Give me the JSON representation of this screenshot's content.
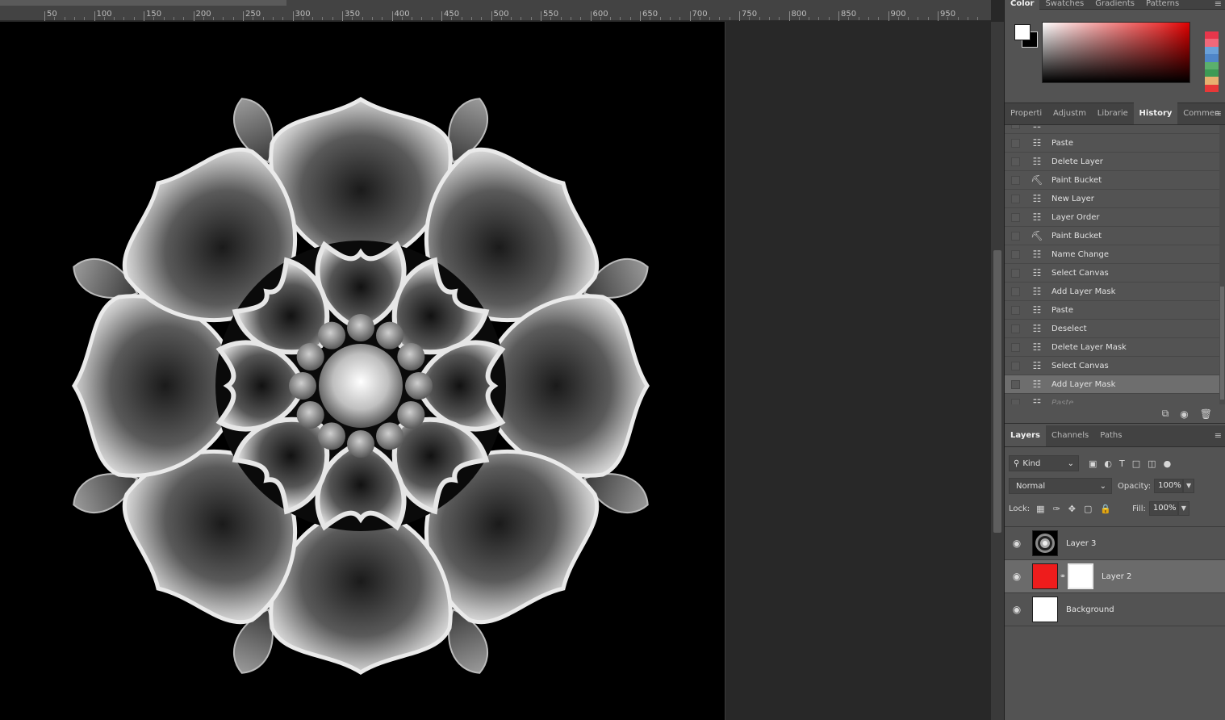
{
  "ruler": {
    "labels": [
      "50",
      "100",
      "150",
      "200",
      "250",
      "300",
      "350",
      "400",
      "450",
      "500",
      "550",
      "600",
      "650",
      "700",
      "750",
      "800",
      "850",
      "900",
      "950"
    ]
  },
  "color_panel": {
    "tabs": [
      "Color",
      "Swatches",
      "Gradients",
      "Patterns"
    ],
    "active_tab": "Color",
    "foreground": "#ffffff",
    "background": "#000000",
    "accent": "#e02020",
    "hue_swatches": [
      "#e8364b",
      "#f0687a",
      "#6aa0d8",
      "#4f86c8",
      "#5bb06c",
      "#3d9a55",
      "#e8b070",
      "#e83838"
    ]
  },
  "history_panel": {
    "tabs": [
      "Properti",
      "Adjustm",
      "Librarie",
      "History",
      "Commen"
    ],
    "active_tab": "History",
    "items": [
      {
        "label": "",
        "icon": "document-icon",
        "state": "normal"
      },
      {
        "label": "Paste",
        "icon": "document-icon",
        "state": "normal"
      },
      {
        "label": "Delete Layer",
        "icon": "document-icon",
        "state": "normal"
      },
      {
        "label": "Paint Bucket",
        "icon": "paint-bucket-icon",
        "state": "normal"
      },
      {
        "label": "New Layer",
        "icon": "document-icon",
        "state": "normal"
      },
      {
        "label": "Layer Order",
        "icon": "document-icon",
        "state": "normal"
      },
      {
        "label": "Paint Bucket",
        "icon": "paint-bucket-icon",
        "state": "normal"
      },
      {
        "label": "Name Change",
        "icon": "document-icon",
        "state": "normal"
      },
      {
        "label": "Select Canvas",
        "icon": "document-icon",
        "state": "normal"
      },
      {
        "label": "Add Layer Mask",
        "icon": "document-icon",
        "state": "normal"
      },
      {
        "label": "Paste",
        "icon": "document-icon",
        "state": "normal"
      },
      {
        "label": "Deselect",
        "icon": "document-icon",
        "state": "normal"
      },
      {
        "label": "Delete Layer Mask",
        "icon": "document-icon",
        "state": "normal"
      },
      {
        "label": "Select Canvas",
        "icon": "document-icon",
        "state": "normal"
      },
      {
        "label": "Add Layer Mask",
        "icon": "document-icon",
        "state": "selected"
      },
      {
        "label": "Paste",
        "icon": "document-icon",
        "state": "dim"
      }
    ],
    "footer_icons": [
      "new-document-from-state-icon",
      "snapshot-camera-icon",
      "trash-icon"
    ]
  },
  "layers_panel": {
    "tabs": [
      "Layers",
      "Channels",
      "Paths"
    ],
    "active_tab": "Layers",
    "filter": {
      "label": "Kind",
      "icons": [
        "image-filter-icon",
        "adjustment-filter-icon",
        "type-filter-icon",
        "shape-filter-icon",
        "smart-object-filter-icon",
        "filter-toggle-icon"
      ]
    },
    "blend_mode": "Normal",
    "opacity_label": "Opacity:",
    "opacity_value": "100%",
    "lock_label": "Lock:",
    "lock_icons": [
      "lock-transparent-icon",
      "lock-paint-icon",
      "lock-move-icon",
      "lock-artboard-icon",
      "lock-all-icon"
    ],
    "fill_label": "Fill:",
    "fill_value": "100%",
    "layers": [
      {
        "name": "Layer 3",
        "thumb": "rosette",
        "mask": false,
        "selected": false
      },
      {
        "name": "Layer 2",
        "thumb": "#ee1c1c",
        "mask": true,
        "selected": true
      },
      {
        "name": "Background",
        "thumb": "#ffffff",
        "mask": false,
        "selected": false
      }
    ]
  }
}
